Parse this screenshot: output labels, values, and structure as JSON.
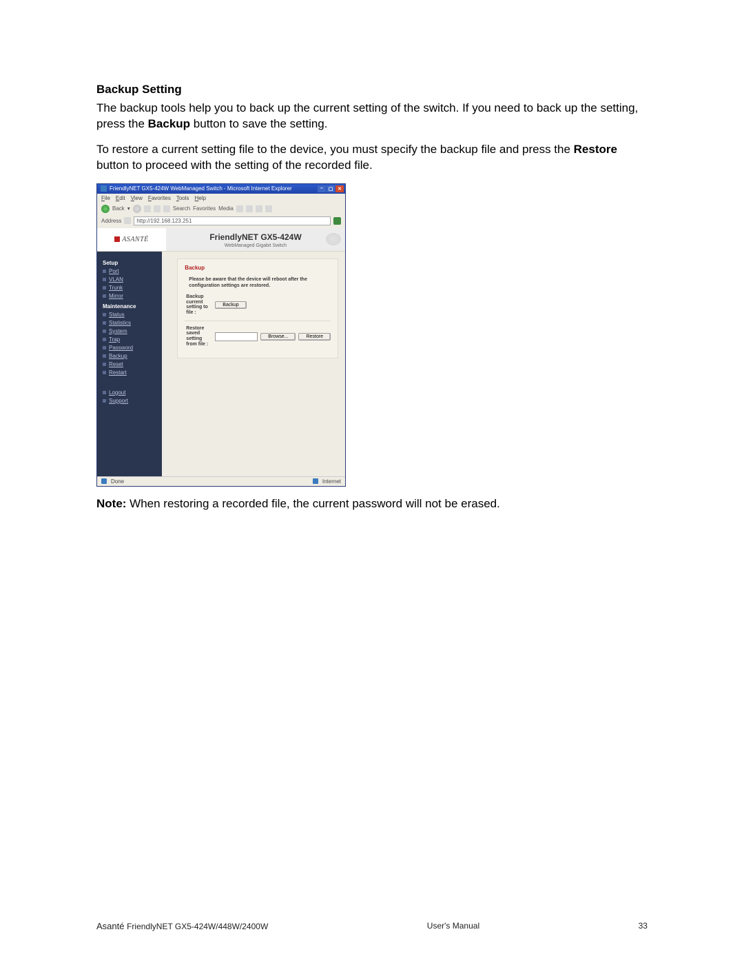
{
  "heading": "Backup Setting",
  "para1_a": "The backup tools help you to back up the current setting of the switch. If you need to back up the setting, press the ",
  "para1_bold": "Backup",
  "para1_b": " button to save the setting.",
  "para2_a": "To restore a current setting file to the device, you must specify the backup file and press the ",
  "para2_bold": "Restore",
  "para2_b": " button to proceed with the setting of the recorded file.",
  "note_label": "Note:",
  "note_text": " When restoring a recorded file, the current password will not be erased.",
  "footer": {
    "left_a": "Asanté ",
    "left_b": "FriendlyNET GX5-424W/448W/2400W",
    "center": "User's Manual",
    "right": "33"
  },
  "ie": {
    "title": "FriendlyNET GX5-424W WebManaged Switch - Microsoft Internet Explorer",
    "menu": [
      "File",
      "Edit",
      "View",
      "Favorites",
      "Tools",
      "Help"
    ],
    "toolbar": {
      "back": "Back",
      "search": "Search",
      "favorites": "Favorites",
      "media": "Media"
    },
    "address_label": "Address",
    "address_url": "http://192.168.123.251",
    "status_done": "Done",
    "status_zone": "Internet"
  },
  "product": {
    "brand": "ASANTÉ",
    "title": "FriendlyNET GX5-424W",
    "sub": "WebManaged Gigabit Switch"
  },
  "sidebar": {
    "section1": "Setup",
    "items1": [
      "Port",
      "VLAN",
      "Trunk",
      "Mirror"
    ],
    "section2": "Maintenance",
    "items2": [
      "Status",
      "Statistics",
      "System",
      "Trap",
      "Password",
      "Backup",
      "Reset",
      "Restart"
    ],
    "items3": [
      "Logout",
      "Support"
    ]
  },
  "panel": {
    "title": "Backup",
    "note": "Please be aware that the device will reboot after the configuration settings are restored.",
    "backup_label": "Backup current setting to file :",
    "backup_btn": "Backup",
    "restore_label": "Restore saved setting from file :",
    "browse_btn": "Browse...",
    "restore_btn": "Restore"
  }
}
